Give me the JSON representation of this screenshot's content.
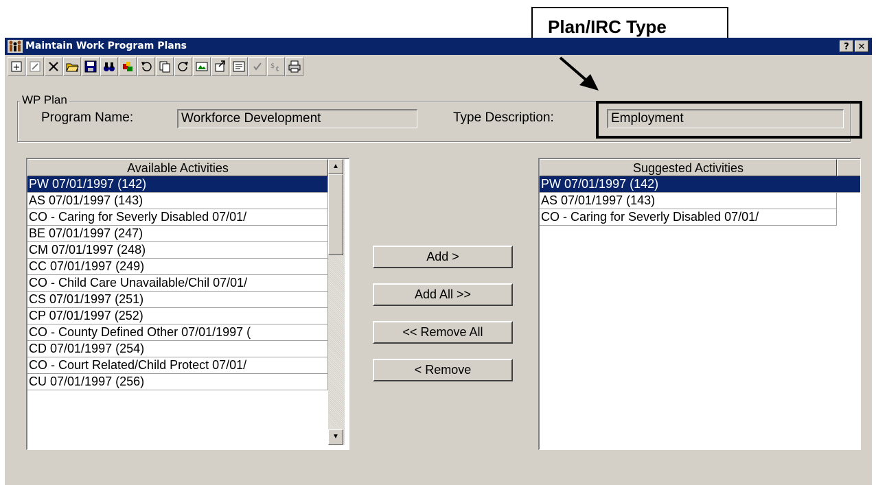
{
  "window": {
    "title": "Maintain Work Program Plans",
    "help_button": "?",
    "close_button": "✕"
  },
  "toolbar": {
    "icons": [
      "new-icon",
      "edit-icon",
      "delete-icon",
      "open-folder-icon",
      "save-icon",
      "binoculars-icon",
      "puzzle-icon",
      "undo-icon",
      "copy-icon",
      "redo-icon",
      "image-icon",
      "export-icon",
      "notes-icon",
      "check-icon",
      "currency-icon",
      "print-icon"
    ]
  },
  "wp_plan": {
    "group_label": "WP Plan",
    "program_name_label": "Program Name:",
    "program_name_value": "Workforce Development",
    "type_description_label": "Type Description:",
    "type_description_value": "Employment"
  },
  "available": {
    "header": "Available Activities",
    "items": [
      "PW 07/01/1997 (142)",
      "AS 07/01/1997 (143)",
      "CO - Caring for Severly Disabled 07/01/",
      "BE 07/01/1997 (247)",
      "CM 07/01/1997 (248)",
      "CC 07/01/1997 (249)",
      "CO - Child Care Unavailable/Chil 07/01/",
      "CS 07/01/1997 (251)",
      "CP 07/01/1997 (252)",
      "CO - County Defined Other 07/01/1997 (",
      "CD 07/01/1997 (254)",
      "CO - Court Related/Child Protect 07/01/",
      "CU 07/01/1997 (256)"
    ]
  },
  "suggested": {
    "header": "Suggested Activities",
    "items": [
      "PW 07/01/1997 (142)",
      "AS 07/01/1997 (143)",
      "CO - Caring for Severly Disabled 07/01/"
    ]
  },
  "buttons": {
    "add": "Add >",
    "add_all": "Add All >>",
    "remove_all": "<< Remove All",
    "remove": "< Remove"
  },
  "annotation": {
    "callout_text": "Plan/IRC Type"
  },
  "colors": {
    "titlebar": "#0a246a",
    "selection": "#0a246a",
    "window_bg": "#d4d0c8"
  }
}
